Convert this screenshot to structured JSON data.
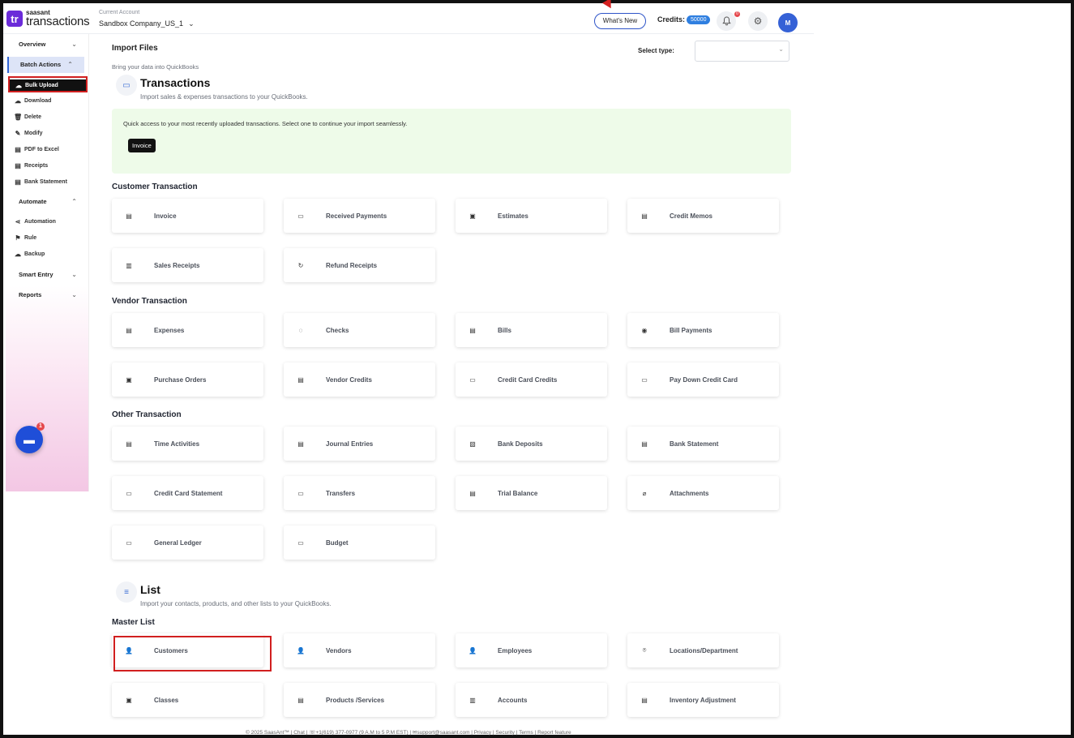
{
  "header": {
    "logo_mark": "tr",
    "logo_brand": "saasant",
    "logo_product": "transactions",
    "account_caption": "Current Account",
    "account_name": "Sandbox Company_US_1",
    "whats_new": "What's New",
    "credits_label": "Credits:",
    "credits_value": "50000",
    "notification_count": "0",
    "avatar_initial": "M"
  },
  "sidebar": {
    "overview": "Overview",
    "batch_actions": "Batch Actions",
    "batch_items": [
      "Bulk Upload",
      "Download",
      "Delete",
      "Modify",
      "PDF to Excel",
      "Receipts",
      "Bank Statement"
    ],
    "automate": "Automate",
    "automate_items": [
      "Automation",
      "Rule",
      "Backup"
    ],
    "smart_entry": "Smart Entry",
    "reports": "Reports",
    "chat_badge": "1"
  },
  "main": {
    "title": "Import Files",
    "subtitle": "Bring your data into QuickBooks",
    "select_label": "Select type:",
    "transactions": {
      "title": "Transactions",
      "desc": "Import sales & expenses transactions to your QuickBooks.",
      "quick_text": "Quick access to your most recently uploaded transactions. Select one to continue your import seamlessly.",
      "quick_chip": "Invoice"
    },
    "customer_group": "Customer Transaction",
    "customer_cards": [
      "Invoice",
      "Received Payments",
      "Estimates",
      "Credit Memos",
      "Sales Receipts",
      "Refund Receipts"
    ],
    "vendor_group": "Vendor Transaction",
    "vendor_cards": [
      "Expenses",
      "Checks",
      "Bills",
      "Bill Payments",
      "Purchase Orders",
      "Vendor Credits",
      "Credit Card Credits",
      "Pay Down Credit Card"
    ],
    "other_group": "Other Transaction",
    "other_cards": [
      "Time Activities",
      "Journal Entries",
      "Bank Deposits",
      "Bank Statement",
      "Credit Card Statement",
      "Transfers",
      "Trial Balance",
      "Attachments",
      "General Ledger",
      "Budget"
    ],
    "list": {
      "title": "List",
      "desc": "Import your contacts, products, and other lists to your QuickBooks."
    },
    "master_group": "Master List",
    "master_cards": [
      "Customers",
      "Vendors",
      "Employees",
      "Locations/Department",
      "Classes",
      "Products /Services",
      "Accounts",
      "Inventory Adjustment"
    ]
  },
  "footer": "© 2025 SaasAnt™ | Chat | ☏+1(619) 377-0977 (9 A.M to 5 P.M EST) | ✉support@saasant.com | Privacy | Security | Terms | Report feature"
}
